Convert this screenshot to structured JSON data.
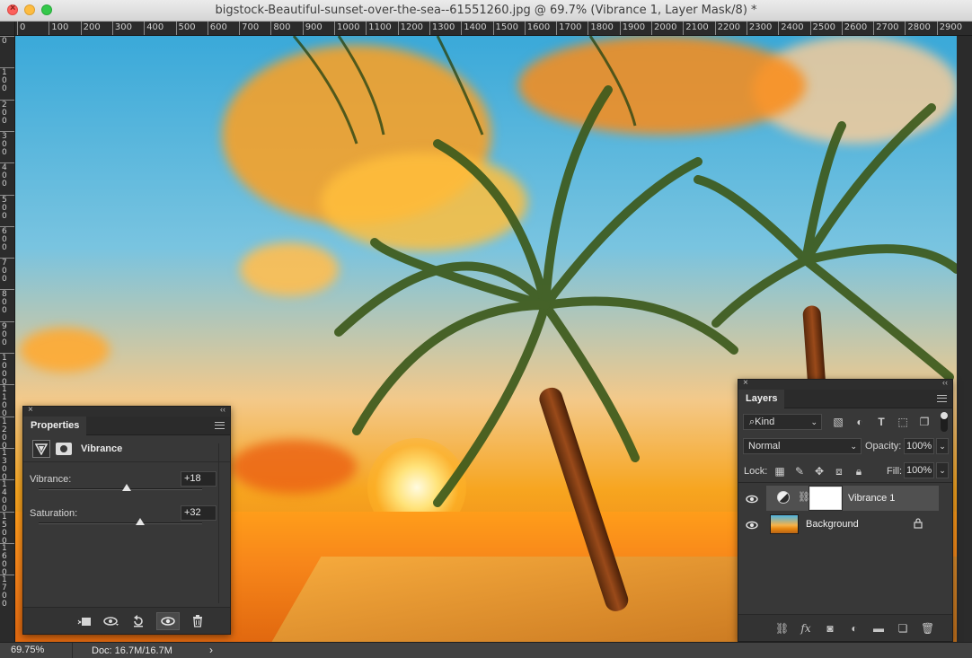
{
  "window": {
    "title": "bigstock-Beautiful-sunset-over-the-sea--61551260.jpg @ 69.7% (Vibrance 1, Layer Mask/8) *"
  },
  "ruler": {
    "top_labels": [
      "0",
      "100",
      "200",
      "300",
      "400",
      "500",
      "600",
      "700",
      "800",
      "900",
      "1000",
      "1100",
      "1200",
      "1300",
      "1400",
      "1500",
      "1600",
      "1700",
      "1800",
      "1900",
      "2000",
      "2100",
      "2200",
      "2300",
      "2400",
      "2500",
      "2600",
      "2700",
      "2800",
      "2900"
    ],
    "left_labels": [
      "0",
      "100",
      "200",
      "300",
      "400",
      "500",
      "600",
      "700",
      "800",
      "900",
      "1000",
      "1100",
      "1200",
      "1300",
      "1400",
      "1500",
      "1600",
      "1700"
    ]
  },
  "properties": {
    "tab": "Properties",
    "adjustment_name": "Vibrance",
    "vibrance_label": "Vibrance:",
    "vibrance_value": "+18",
    "vibrance_fraction": 0.54,
    "saturation_label": "Saturation:",
    "saturation_value": "+32",
    "saturation_fraction": 0.62,
    "icons": [
      "clip-to-layer-icon",
      "view-previous-state-icon",
      "reset-icon",
      "visibility-icon",
      "trash-icon"
    ]
  },
  "layers": {
    "tab": "Layers",
    "filter_kind": "Kind",
    "blend_mode": "Normal",
    "opacity_label": "Opacity:",
    "opacity_value": "100%",
    "lock_label": "Lock:",
    "fill_label": "Fill:",
    "fill_value": "100%",
    "items": [
      {
        "name": "Vibrance 1",
        "selected": true,
        "visible": true
      },
      {
        "name": "Background",
        "selected": false,
        "visible": true,
        "locked": true
      }
    ]
  },
  "status": {
    "zoom": "69.75%",
    "doc": "Doc: 16.7M/16.7M"
  }
}
